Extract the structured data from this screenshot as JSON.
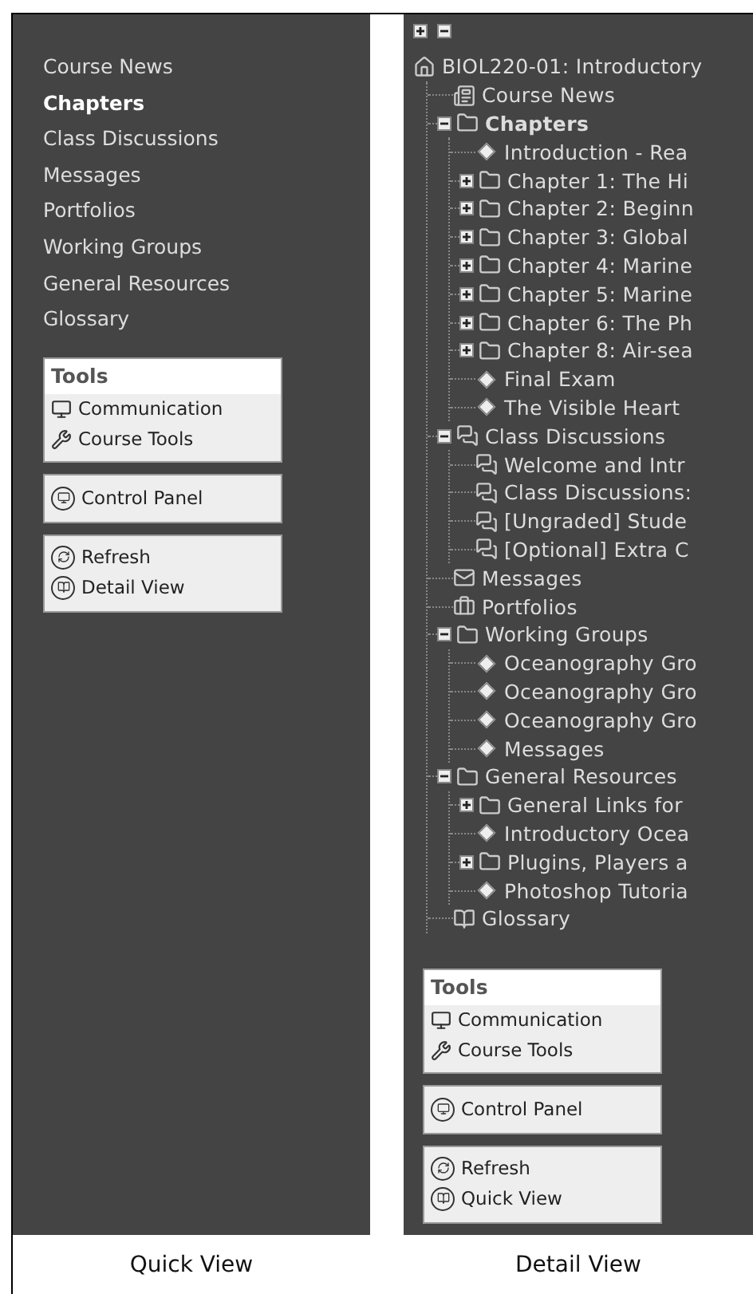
{
  "quick_view": {
    "nav_items": [
      {
        "label": "Course News",
        "selected": false
      },
      {
        "label": "Chapters",
        "selected": true
      },
      {
        "label": "Class Discussions",
        "selected": false
      },
      {
        "label": "Messages",
        "selected": false
      },
      {
        "label": "Portfolios",
        "selected": false
      },
      {
        "label": "Working Groups",
        "selected": false
      },
      {
        "label": "General Resources",
        "selected": false
      },
      {
        "label": "Glossary",
        "selected": false
      }
    ],
    "tools": {
      "title": "Tools",
      "items": [
        {
          "label": "Communication",
          "kind": "communication"
        },
        {
          "label": "Course Tools",
          "kind": "course_tools"
        }
      ]
    },
    "control_panel": {
      "label": "Control Panel",
      "kind": "control_panel"
    },
    "actions": [
      {
        "label": "Refresh",
        "kind": "refresh"
      },
      {
        "label": "Detail View",
        "kind": "view"
      }
    ],
    "caption": "Quick View"
  },
  "detail_view": {
    "tree": {
      "label": "BIOL220-01: Introductory",
      "kind": "home",
      "selected": false,
      "children": [
        {
          "label": "Course News",
          "kind": "news",
          "selected": false
        },
        {
          "label": "Chapters",
          "kind": "folder",
          "selected": true,
          "expanded": true,
          "children": [
            {
              "label": "Introduction - Rea",
              "kind": "page",
              "selected": false
            },
            {
              "label": "Chapter 1: The Hi",
              "kind": "folder",
              "selected": false,
              "expanded": false
            },
            {
              "label": "Chapter 2: Beginn",
              "kind": "folder",
              "selected": false,
              "expanded": false
            },
            {
              "label": "Chapter 3: Global",
              "kind": "folder",
              "selected": false,
              "expanded": false
            },
            {
              "label": "Chapter 4: Marine",
              "kind": "folder",
              "selected": false,
              "expanded": false
            },
            {
              "label": "Chapter 5: Marine",
              "kind": "folder",
              "selected": false,
              "expanded": false
            },
            {
              "label": "Chapter 6: The Ph",
              "kind": "folder",
              "selected": false,
              "expanded": false
            },
            {
              "label": "Chapter 8: Air-sea",
              "kind": "folder",
              "selected": false,
              "expanded": false
            },
            {
              "label": "Final Exam",
              "kind": "page",
              "selected": false
            },
            {
              "label": "The Visible Heart",
              "kind": "page",
              "selected": false
            }
          ]
        },
        {
          "label": "Class Discussions",
          "kind": "discussion",
          "selected": false,
          "expanded": true,
          "children": [
            {
              "label": "Welcome and Intr",
              "kind": "discussion",
              "selected": false
            },
            {
              "label": "Class Discussions:",
              "kind": "discussion",
              "selected": false
            },
            {
              "label": "[Ungraded] Stude",
              "kind": "discussion",
              "selected": false
            },
            {
              "label": "[Optional] Extra C",
              "kind": "discussion",
              "selected": false
            }
          ]
        },
        {
          "label": "Messages",
          "kind": "messages",
          "selected": false
        },
        {
          "label": "Portfolios",
          "kind": "portfolio",
          "selected": false
        },
        {
          "label": "Working Groups",
          "kind": "folder",
          "selected": false,
          "expanded": true,
          "children": [
            {
              "label": "Oceanography Gro",
              "kind": "page",
              "selected": false
            },
            {
              "label": "Oceanography Gro",
              "kind": "page",
              "selected": false
            },
            {
              "label": "Oceanography Gro",
              "kind": "page",
              "selected": false
            },
            {
              "label": "Messages",
              "kind": "page",
              "selected": false
            }
          ]
        },
        {
          "label": "General Resources",
          "kind": "folder",
          "selected": false,
          "expanded": true,
          "children": [
            {
              "label": "General Links for",
              "kind": "folder",
              "selected": false,
              "expanded": false
            },
            {
              "label": "Introductory Ocea",
              "kind": "page",
              "selected": false
            },
            {
              "label": "Plugins, Players a",
              "kind": "folder",
              "selected": false,
              "expanded": false
            },
            {
              "label": "Photoshop Tutoria",
              "kind": "page",
              "selected": false
            }
          ]
        },
        {
          "label": "Glossary",
          "kind": "glossary",
          "selected": false
        }
      ]
    },
    "tools": {
      "title": "Tools",
      "items": [
        {
          "label": "Communication",
          "kind": "communication"
        },
        {
          "label": "Course Tools",
          "kind": "course_tools"
        }
      ]
    },
    "control_panel": {
      "label": "Control Panel",
      "kind": "control_panel"
    },
    "actions": [
      {
        "label": "Refresh",
        "kind": "refresh"
      },
      {
        "label": "Quick View",
        "kind": "view"
      }
    ],
    "caption": "Detail View"
  }
}
